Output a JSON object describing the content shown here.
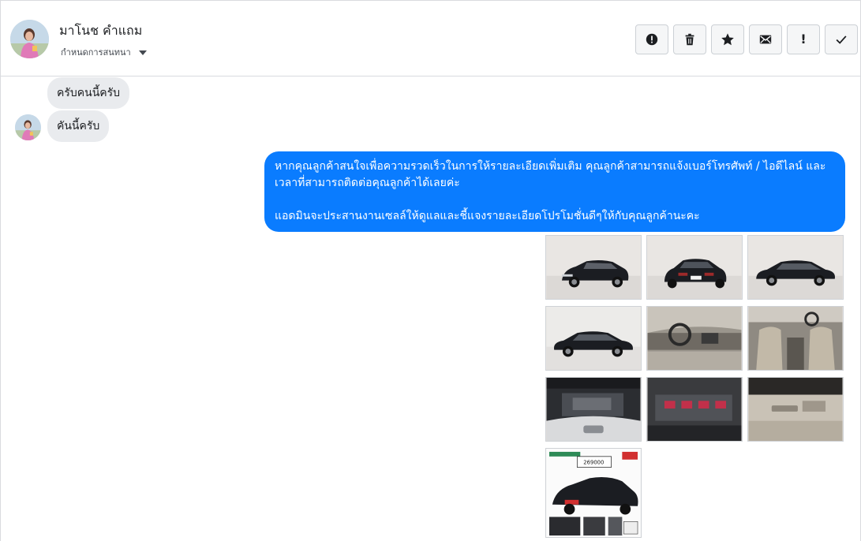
{
  "header": {
    "user_name": "มาโนช คำแถม",
    "conversation_menu_label": "กำหนดการสนทนา",
    "actions": [
      {
        "name": "report-button",
        "icon": "alert-circle-icon"
      },
      {
        "name": "delete-button",
        "icon": "trash-icon"
      },
      {
        "name": "star-button",
        "icon": "star-icon"
      },
      {
        "name": "mark-unread-button",
        "icon": "envelope-icon"
      },
      {
        "name": "mark-important-button",
        "icon": "exclamation-icon",
        "glyph": "!"
      },
      {
        "name": "mark-done-button",
        "icon": "check-icon"
      }
    ]
  },
  "messages": {
    "incoming_1": "ครับคนนี้ครับ",
    "incoming_2": "คันนี้ครับ",
    "outgoing_para_1": "หากคุณลูกค้าสนใจเพื่อความรวดเร็วในการให้รายละเอียดเพิ่มเติม คุณลูกค้าสามารถแจ้งเบอร์โทรศัพท์ / ไอดีไลน์ และเวลาที่สามารถติดต่อคุณลูกค้าได้เลยค่ะ",
    "outgoing_para_2": "แอดมินจะประสานงานเซลล์ให้ดูแลและชี้แจงรายละเอียดโปรโมชั่นดีๆให้กับคุณลูกค้านะคะ"
  },
  "photos": [
    {
      "name": "photo-car-front-left",
      "subject": "black sedan front three-quarter view"
    },
    {
      "name": "photo-car-rear",
      "subject": "black sedan rear view"
    },
    {
      "name": "photo-car-side-right",
      "subject": "black sedan side view"
    },
    {
      "name": "photo-car-side-left",
      "subject": "black sedan left side view"
    },
    {
      "name": "photo-dashboard",
      "subject": "interior dashboard"
    },
    {
      "name": "photo-front-seats",
      "subject": "interior front seats"
    },
    {
      "name": "photo-engine-bay",
      "subject": "open hood engine bay"
    },
    {
      "name": "photo-engine-detail",
      "subject": "engine close-up"
    },
    {
      "name": "photo-door-panel",
      "subject": "door interior panel"
    },
    {
      "name": "photo-promo-poster",
      "subject": "sale promotion poster",
      "price": "269000"
    }
  ],
  "colors": {
    "outgoing_bubble": "#0a7cff",
    "incoming_bubble": "#e9ebee",
    "car_body": "#1b1d22"
  }
}
